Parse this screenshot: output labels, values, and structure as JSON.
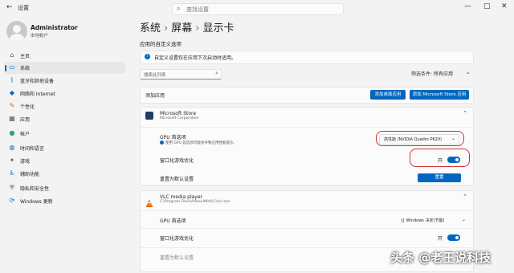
{
  "window": {
    "app_title": "设置",
    "search_placeholder": "查找设置",
    "controls": [
      "—",
      "□",
      "✕"
    ]
  },
  "user": {
    "name": "Administrator",
    "type": "本地帐户"
  },
  "sidebar": {
    "items": [
      {
        "label": "主页",
        "icon": "home-icon",
        "glyph": "⌂",
        "color": "#555555"
      },
      {
        "label": "系统",
        "icon": "monitor-icon",
        "glyph": "▭",
        "color": "#0067c0",
        "active": true
      },
      {
        "label": "蓝牙和其他设备",
        "icon": "bluetooth-icon",
        "glyph": "ᛒ",
        "color": "#0067c0"
      },
      {
        "label": "网络和 Internet",
        "icon": "wifi-icon",
        "glyph": "◆",
        "color": "#0067c0"
      },
      {
        "label": "个性化",
        "icon": "brush-icon",
        "glyph": "✎",
        "color": "#c46a1a"
      },
      {
        "label": "应用",
        "icon": "apps-icon",
        "glyph": "▦",
        "color": "#555555"
      },
      {
        "label": "帐户",
        "icon": "account-icon",
        "glyph": "●",
        "color": "#2aa36b"
      },
      {
        "label": "时间和语言",
        "icon": "globe-icon",
        "glyph": "◍",
        "color": "#0067c0"
      },
      {
        "label": "游戏",
        "icon": "gamepad-icon",
        "glyph": "✦",
        "color": "#666666"
      },
      {
        "label": "辅助功能",
        "icon": "accessibility-icon",
        "glyph": "♿",
        "color": "#0067c0"
      },
      {
        "label": "隐私和安全性",
        "icon": "shield-icon",
        "glyph": "⛨",
        "color": "#666666"
      },
      {
        "label": "Windows 更新",
        "icon": "update-icon",
        "glyph": "⟳",
        "color": "#0067c0"
      }
    ]
  },
  "breadcrumb": {
    "part1": "系统",
    "part2": "屏幕",
    "part3": "显示卡",
    "separator": "›"
  },
  "main": {
    "section_title": "应用的自定义选项",
    "info_text": "自定义设置仅在应用下次启动时适用。",
    "filter": {
      "search_placeholder": "搜索此列表",
      "label": "筛选条件:",
      "selected": "所有应用"
    },
    "add_app": {
      "label": "添加应用",
      "desktop_button": "添加桌面应用",
      "store_button": "添加 Microsoft Store 应用"
    },
    "apps": [
      {
        "name": "Microsoft Store",
        "publisher": "Microsoft Corporation",
        "gpu_label": "GPU 首选项",
        "gpu_note": "使用 GPU 首选项可能会导致应用性能提升。",
        "gpu_value": "高性能 (NVIDIA Quadro P620)",
        "window_opt_label": "窗口化游戏优化",
        "window_opt_state": "开",
        "reset_label": "重置为默认设置",
        "reset_button": "重置"
      },
      {
        "name": "VLC media player",
        "path": "C:\\Program Files\\VideoLAN\\VLC\\vlc.exe",
        "gpu_label": "GPU 首选项",
        "gpu_value": "让 Windows 决定(节能)",
        "window_opt_label": "窗口化游戏优化",
        "window_opt_state": "开",
        "reset_label": "重置为默认设置"
      }
    ]
  },
  "watermark": "头条 @老王说科技",
  "colors": {
    "accent": "#0067c0",
    "highlight_ring": "#d0302f",
    "vlc_orange": "#f08a1c"
  }
}
